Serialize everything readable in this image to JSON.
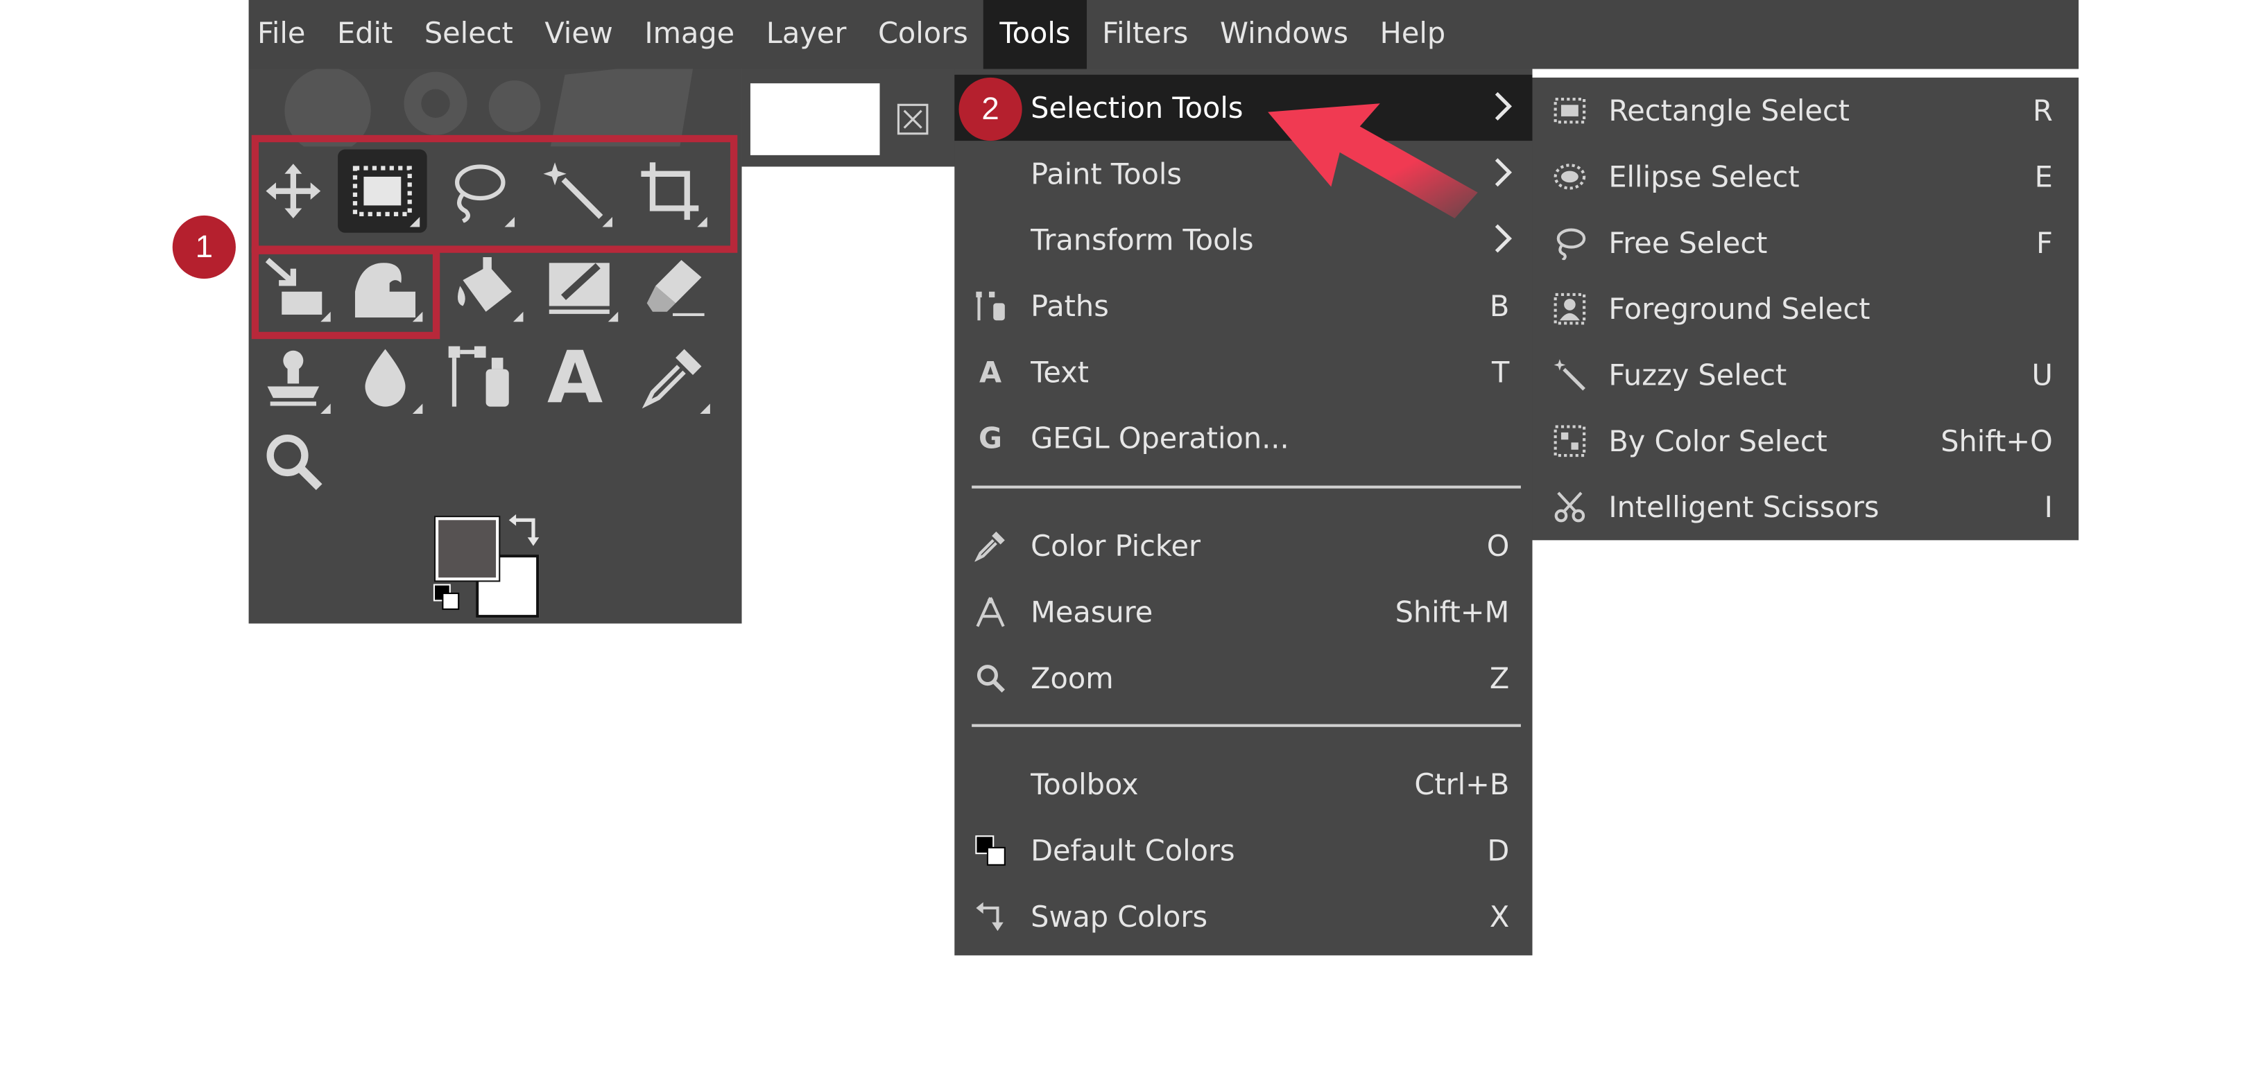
{
  "menubar": {
    "items": [
      "File",
      "Edit",
      "Select",
      "View",
      "Image",
      "Layer",
      "Colors",
      "Tools",
      "Filters",
      "Windows",
      "Help"
    ],
    "active_item": "Tools"
  },
  "toolbox": {
    "tools": [
      {
        "name": "move-tool",
        "icon": "move-icon"
      },
      {
        "name": "rectangle-select-tool",
        "icon": "rectangle-select-icon",
        "selected": true
      },
      {
        "name": "free-select-tool",
        "icon": "lasso-icon"
      },
      {
        "name": "fuzzy-select-tool",
        "icon": "magic-wand-icon"
      },
      {
        "name": "crop-tool",
        "icon": "crop-icon"
      },
      {
        "name": "unified-transform-tool",
        "icon": "transform-icon"
      },
      {
        "name": "warp-transform-tool",
        "icon": "warp-icon"
      },
      {
        "name": "bucket-fill-tool",
        "icon": "bucket-icon"
      },
      {
        "name": "paintbrush-tool",
        "icon": "brush-icon"
      },
      {
        "name": "eraser-tool",
        "icon": "eraser-icon"
      },
      {
        "name": "clone-tool",
        "icon": "clone-icon"
      },
      {
        "name": "smudge-tool",
        "icon": "drop-icon"
      },
      {
        "name": "paths-tool",
        "icon": "paths-icon"
      },
      {
        "name": "text-tool",
        "icon": "text-icon",
        "glyph": "A"
      },
      {
        "name": "color-picker-tool",
        "icon": "color-picker-icon"
      },
      {
        "name": "zoom-tool",
        "icon": "zoom-icon"
      }
    ],
    "foreground_color": "#565252",
    "background_color": "#ffffff"
  },
  "tools_menu": {
    "items": [
      {
        "label": "Selection Tools",
        "shortcut": "",
        "icon": "",
        "submenu": true
      },
      {
        "label": "Paint Tools",
        "shortcut": "",
        "icon": "",
        "submenu": true
      },
      {
        "label": "Transform Tools",
        "shortcut": "",
        "icon": "",
        "submenu": true
      },
      {
        "label": "Paths",
        "shortcut": "B",
        "icon": "paths-icon"
      },
      {
        "label": "Text",
        "shortcut": "T",
        "icon": "text-icon",
        "glyph": "A"
      },
      {
        "label": "GEGL Operation...",
        "shortcut": "",
        "icon": "gegl-icon",
        "glyph": "G"
      },
      {
        "label": "Color Picker",
        "shortcut": "O",
        "icon": "color-picker-icon"
      },
      {
        "label": "Measure",
        "shortcut": "Shift+M",
        "icon": "measure-icon"
      },
      {
        "label": "Zoom",
        "shortcut": "Z",
        "icon": "zoom-icon"
      },
      {
        "label": "Toolbox",
        "shortcut": "Ctrl+B",
        "icon": ""
      },
      {
        "label": "Default Colors",
        "shortcut": "D",
        "icon": "default-colors-icon"
      },
      {
        "label": "Swap Colors",
        "shortcut": "X",
        "icon": "swap-colors-icon"
      }
    ]
  },
  "selection_submenu": {
    "items": [
      {
        "label": "Rectangle Select",
        "shortcut": "R",
        "icon": "rectangle-select-icon"
      },
      {
        "label": "Ellipse Select",
        "shortcut": "E",
        "icon": "ellipse-select-icon"
      },
      {
        "label": "Free Select",
        "shortcut": "F",
        "icon": "lasso-icon"
      },
      {
        "label": "Foreground Select",
        "shortcut": "",
        "icon": "foreground-select-icon"
      },
      {
        "label": "Fuzzy Select",
        "shortcut": "U",
        "icon": "magic-wand-icon"
      },
      {
        "label": "By Color Select",
        "shortcut": "Shift+O",
        "icon": "by-color-select-icon"
      },
      {
        "label": "Intelligent Scissors",
        "shortcut": "I",
        "icon": "scissors-icon"
      }
    ]
  },
  "badges": {
    "first": "1",
    "second": "2"
  },
  "colors": {
    "menu_bg": "#474747",
    "highlight_bg": "#1e1e1e",
    "accent_red": "#b5202e",
    "arrow_red": "#f03a52"
  }
}
